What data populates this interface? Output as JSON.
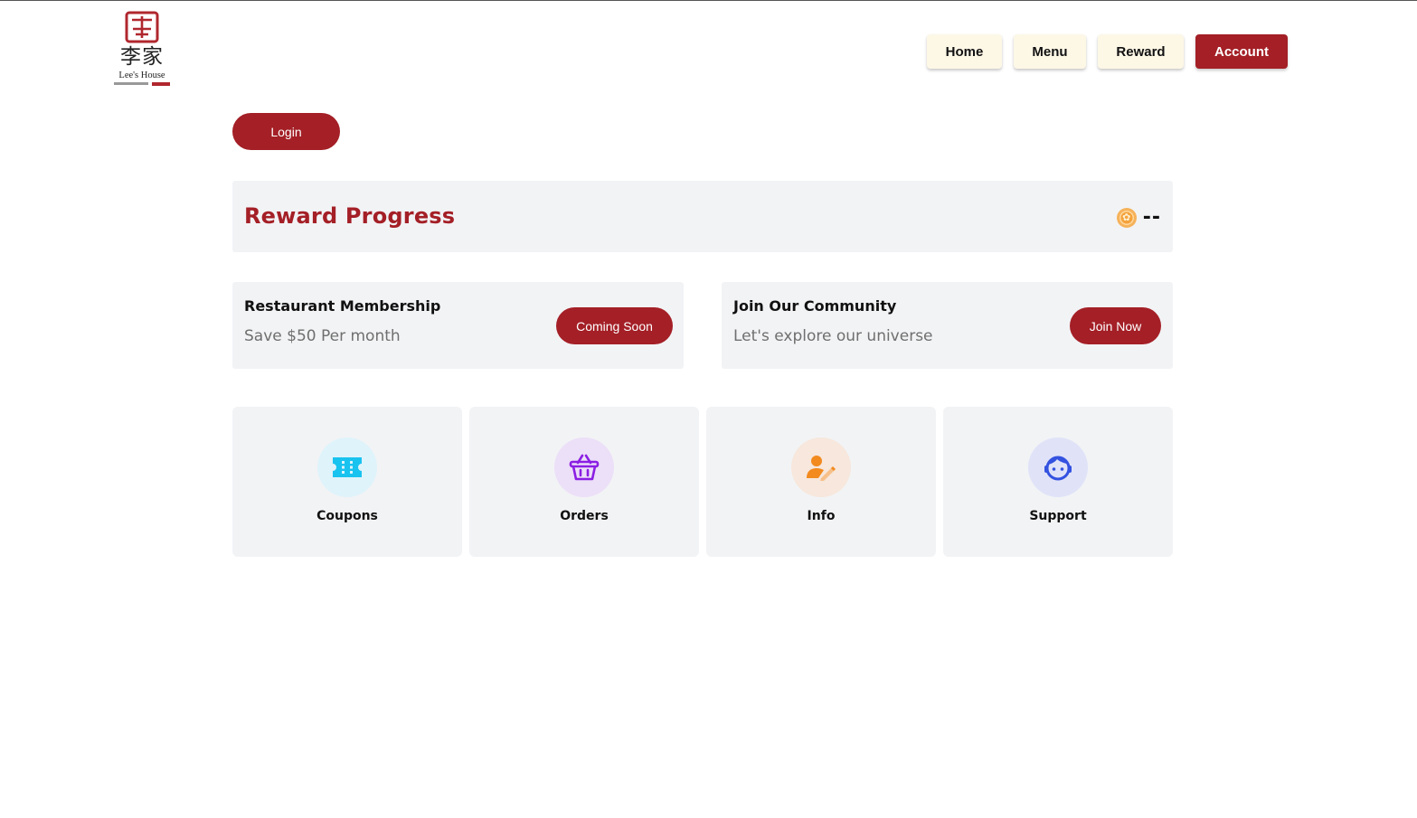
{
  "brand": {
    "seal_text": "李",
    "name_cn": "李家",
    "name_en": "Lee's House"
  },
  "nav": {
    "home": "Home",
    "menu": "Menu",
    "reward": "Reward",
    "account": "Account"
  },
  "login_label": "Login",
  "reward_progress": {
    "title": "Reward Progress",
    "points": "--",
    "icon": "coin-icon"
  },
  "membership": {
    "title": "Restaurant Membership",
    "subtitle": "Save $50 Per month",
    "button": "Coming Soon"
  },
  "community": {
    "title": "Join Our Community",
    "subtitle": "Let's explore our universe",
    "button": "Join Now"
  },
  "tiles": [
    {
      "label": "Coupons",
      "icon": "ticket-icon",
      "bg": "#dff3fb",
      "color": "#19c3ef"
    },
    {
      "label": "Orders",
      "icon": "basket-icon",
      "bg": "#ecdff8",
      "color": "#8b1fe3"
    },
    {
      "label": "Info",
      "icon": "user-edit-icon",
      "bg": "#f7e7dc",
      "color": "#f28a1f"
    },
    {
      "label": "Support",
      "icon": "support-agent-icon",
      "bg": "#e0e3f8",
      "color": "#3452e0"
    }
  ],
  "colors": {
    "accent": "#a41f26",
    "nav_light_bg": "#fdf7e6",
    "panel_bg": "#f2f3f5"
  }
}
